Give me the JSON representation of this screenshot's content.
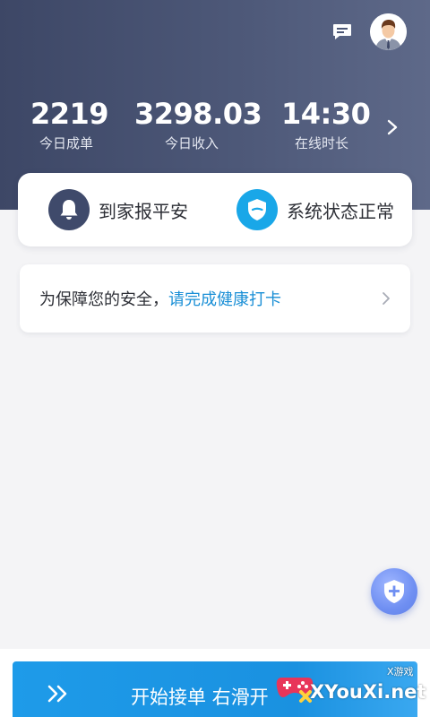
{
  "stats": {
    "orders_today": {
      "value": "2219",
      "label": "今日成单"
    },
    "income_today": {
      "value": "3298.03",
      "label": "今日收入"
    },
    "online_time": {
      "value": "14:30",
      "label": "在线时长"
    }
  },
  "safety": {
    "home_safe_label": "到家报平安",
    "system_status_label": "系统状态正常"
  },
  "health": {
    "prefix": "为保障您的安全，",
    "link": "请完成健康打卡"
  },
  "bottom": {
    "slide_label": "开始接单 右滑开"
  },
  "watermark": {
    "small": "X游戏",
    "main": "XYouXi.net"
  },
  "icons": {
    "header": [
      "message-icon",
      "avatar"
    ],
    "stats": "chevron-right-icon",
    "safety": [
      "bell-icon",
      "shield-icon"
    ],
    "fab": "shield-plus-icon",
    "slide": "double-chevron-right-icon"
  },
  "colors": {
    "header_bg": "#4a5575",
    "accent_blue": "#1a8fd6",
    "slide_bar": "#1e9be9",
    "status_blue": "#19a7e8",
    "bell_bg": "#3f4a6b"
  }
}
